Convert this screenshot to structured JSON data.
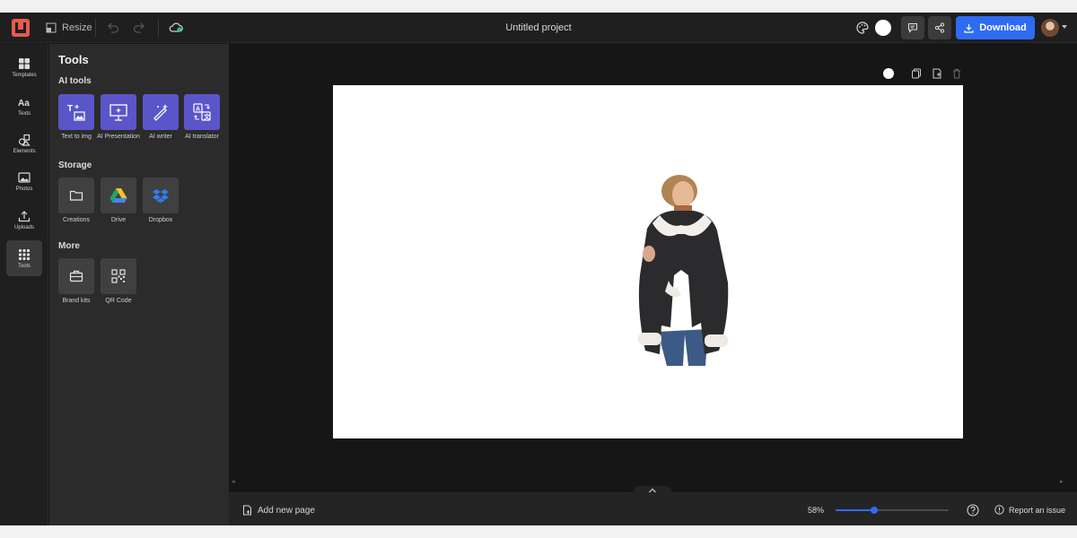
{
  "topbar": {
    "resize_label": "Resize",
    "project_title": "Untitled project",
    "download_label": "Download",
    "icons": [
      "logo-icon",
      "resize-icon",
      "undo-icon",
      "redo-icon",
      "cloud-sync-icon",
      "palette-icon",
      "comment-icon",
      "share-icon",
      "download-icon",
      "avatar",
      "chevron-down-icon"
    ],
    "accent": "#2f6bf2"
  },
  "rail": {
    "items": [
      {
        "label": "Templates",
        "icon": "templates-icon"
      },
      {
        "label": "Texts",
        "icon": "text-icon"
      },
      {
        "label": "Elements",
        "icon": "elements-icon"
      },
      {
        "label": "Photos",
        "icon": "photo-icon"
      },
      {
        "label": "Uploads",
        "icon": "upload-icon"
      },
      {
        "label": "Tools",
        "icon": "grid-icon"
      }
    ],
    "active": "Tools"
  },
  "panel": {
    "title": "Tools",
    "sections": {
      "ai": {
        "title": "AI tools",
        "items": [
          {
            "label": "Text to img"
          },
          {
            "label": "AI Presentation"
          },
          {
            "label": "AI writer"
          },
          {
            "label": "AI translator"
          }
        ]
      },
      "storage": {
        "title": "Storage",
        "items": [
          {
            "label": "Creations"
          },
          {
            "label": "Drive"
          },
          {
            "label": "Dropbox"
          }
        ]
      },
      "more": {
        "title": "More",
        "items": [
          {
            "label": "Brand kits"
          },
          {
            "label": "QR Code"
          }
        ]
      }
    },
    "ai_color": "#5a55c8"
  },
  "bottombar": {
    "add_page_label": "Add new page",
    "zoom_label": "58%",
    "zoom_fraction": 0.34,
    "report_label": "Report an issue"
  }
}
